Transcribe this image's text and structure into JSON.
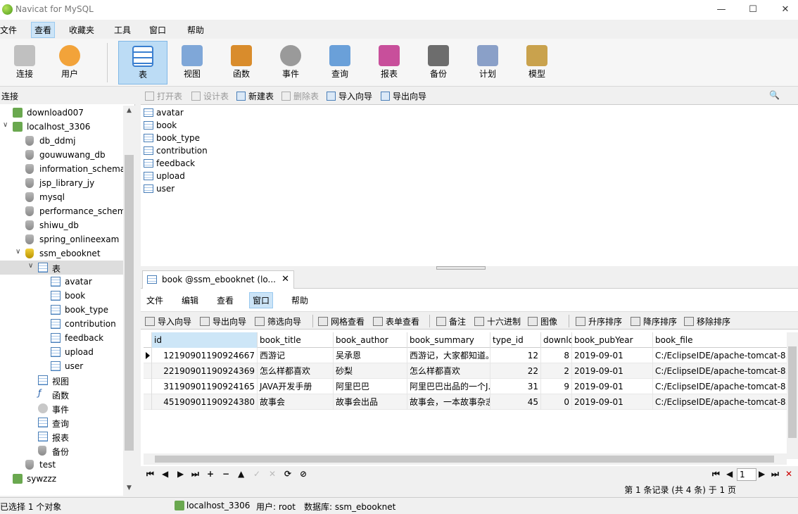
{
  "window": {
    "title": "Navicat for MySQL",
    "controls": [
      "—",
      "☐",
      "✕"
    ]
  },
  "menu": [
    "文件",
    "查看",
    "收藏夹",
    "工具",
    "窗口",
    "帮助"
  ],
  "toolbar": [
    {
      "label": "连接",
      "color": "#c0c0c0"
    },
    {
      "label": "用户",
      "color": "#f2a33a"
    },
    {
      "label": "表",
      "color": "#3a7fd0"
    },
    {
      "label": "视图",
      "color": "#7fa7d8"
    },
    {
      "label": "函数",
      "color": "#d98c2c"
    },
    {
      "label": "事件",
      "color": "#9a9a9a"
    },
    {
      "label": "查询",
      "color": "#6aa0d9"
    },
    {
      "label": "报表",
      "color": "#c84f9b"
    },
    {
      "label": "备份",
      "color": "#6d6d6d"
    },
    {
      "label": "计划",
      "color": "#8aa0c8"
    },
    {
      "label": "模型",
      "color": "#c9a24d"
    }
  ],
  "left_header": "连接",
  "tree": [
    {
      "label": "download007",
      "type": "conn",
      "level": 0
    },
    {
      "label": "localhost_3306",
      "type": "conn-on",
      "level": 0,
      "toggle": "∨"
    },
    {
      "label": "db_ddmj",
      "type": "db",
      "level": 1
    },
    {
      "label": "gouwuwang_db",
      "type": "db",
      "level": 1
    },
    {
      "label": "information_schema",
      "type": "db",
      "level": 1
    },
    {
      "label": "jsp_library_jy",
      "type": "db",
      "level": 1
    },
    {
      "label": "mysql",
      "type": "db",
      "level": 1
    },
    {
      "label": "performance_schem",
      "type": "db",
      "level": 1
    },
    {
      "label": "shiwu_db",
      "type": "db",
      "level": 1
    },
    {
      "label": "spring_onlineexam",
      "type": "db",
      "level": 1
    },
    {
      "label": "ssm_ebooknet",
      "type": "db-on",
      "level": 1,
      "toggle": "∨"
    },
    {
      "label": "表",
      "type": "table",
      "level": 2,
      "toggle": "∨",
      "selected": true
    },
    {
      "label": "avatar",
      "type": "table",
      "level": 3
    },
    {
      "label": "book",
      "type": "table",
      "level": 3
    },
    {
      "label": "book_type",
      "type": "table",
      "level": 3
    },
    {
      "label": "contribution",
      "type": "table",
      "level": 3
    },
    {
      "label": "feedback",
      "type": "table",
      "level": 3
    },
    {
      "label": "upload",
      "type": "table",
      "level": 3
    },
    {
      "label": "user",
      "type": "table",
      "level": 3
    },
    {
      "label": "视图",
      "type": "view",
      "level": 2
    },
    {
      "label": "函数",
      "type": "func",
      "level": 2
    },
    {
      "label": "事件",
      "type": "event",
      "level": 2
    },
    {
      "label": "查询",
      "type": "query",
      "level": 2
    },
    {
      "label": "报表",
      "type": "report",
      "level": 2
    },
    {
      "label": "备份",
      "type": "backup",
      "level": 2
    },
    {
      "label": "test",
      "type": "db",
      "level": 1
    },
    {
      "label": "sywzzz",
      "type": "conn",
      "level": 0
    }
  ],
  "object_toolbar": [
    {
      "label": "打开表",
      "disabled": true
    },
    {
      "label": "设计表",
      "disabled": true
    },
    {
      "label": "新建表",
      "disabled": false
    },
    {
      "label": "删除表",
      "disabled": true
    },
    {
      "label": "导入向导",
      "disabled": false
    },
    {
      "label": "导出向导",
      "disabled": false
    }
  ],
  "object_list": [
    "avatar",
    "book",
    "book_type",
    "contribution",
    "feedback",
    "upload",
    "user"
  ],
  "tab": {
    "label": "book @ssm_ebooknet (lo...",
    "close": "✕"
  },
  "sub_menu": [
    "文件",
    "编辑",
    "查看",
    "窗口",
    "帮助"
  ],
  "sub_toolbar": [
    "导入向导",
    "导出向导",
    "筛选向导",
    "网格查看",
    "表单查看",
    "备注",
    "十六进制",
    "图像",
    "升序排序",
    "降序排序",
    "移除排序"
  ],
  "grid": {
    "columns": [
      "id",
      "book_title",
      "book_author",
      "book_summary",
      "type_id",
      "downlo",
      "book_pubYear",
      "book_file"
    ],
    "rows": [
      [
        "12190901190924667",
        "西游记",
        "吴承恩",
        "西游记，大家都知道。",
        "12",
        "8",
        "2019-09-01",
        "C:/EclipseIDE/apache-tomcat-8."
      ],
      [
        "22190901190924369",
        "怎么样都喜欢",
        "砂梨",
        "怎么样都喜欢",
        "22",
        "2",
        "2019-09-01",
        "C:/EclipseIDE/apache-tomcat-8."
      ],
      [
        "31190901190924165",
        "JAVA开发手册",
        "阿里巴巴",
        "阿里巴巴出品的一个J.",
        "31",
        "9",
        "2019-09-01",
        "C:/EclipseIDE/apache-tomcat-8."
      ],
      [
        "45190901190924380",
        "故事会",
        "故事会出品",
        "故事会，一本故事杂志",
        "45",
        "0",
        "2019-09-01",
        "C:/EclipseIDE/apache-tomcat-8."
      ]
    ]
  },
  "nav_buttons": [
    "⏮",
    "◀",
    "▶",
    "⏭",
    "+",
    "−",
    "▲",
    "✓",
    "✕",
    "⟳",
    "⊘"
  ],
  "pager": {
    "first": "⏮",
    "prev": "◀",
    "page": "1",
    "next": "▶",
    "last": "⏭",
    "close": "✕"
  },
  "record_info": "第 1 条记录 (共 4 条) 于 1 页",
  "status": {
    "selection": "已选择 1 个对象",
    "connection": "localhost_3306",
    "user": "用户: root",
    "database": "数据库: ssm_ebooknet"
  }
}
